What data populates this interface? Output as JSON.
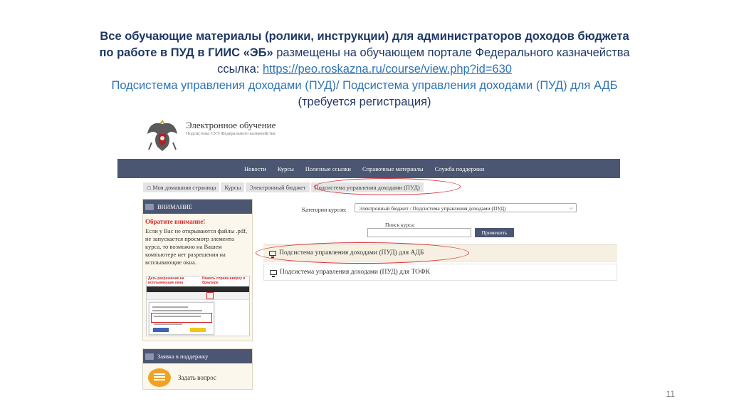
{
  "slide": {
    "title_line1": "Все обучающие материалы (ролики, инструкции) для администраторов доходов бюджета",
    "title_line2_bold": "по работе в ПУД в ГИИС «ЭБ»",
    "title_line2_rest": " размещены на обучающем  портале Федерального казначейства",
    "link_prefix": "ссылка: ",
    "link_url": "https://peo.roskazna.ru/course/view.php?id=630",
    "subsystems": "Подсистема управления доходами (ПУД)/ Подсистема управления доходами (ПУД) для АДБ",
    "registration_note": "(требуется регистрация)",
    "page_number": "11"
  },
  "site": {
    "logo_title": "Электронное обучение",
    "logo_subtitle": "Подсистема СУЭ Федерального казначейства",
    "nav": [
      "Новости",
      "Курсы",
      "Полезные ссылки",
      "Справочные материалы",
      "Служба поддержки"
    ],
    "breadcrumb": [
      "Моя домашняя страница",
      "Курсы",
      "Электронный бюджет",
      "Подсистема управления доходами (ПУД)"
    ],
    "home_icon": "home-icon"
  },
  "notice": {
    "header": "ВНИМАНИЕ",
    "title": "Обратите внимание!",
    "text": "Если у Вас не открываются файлы .pdf, не запускается просмотр элемента курса, то возможно на Вашем компьютере нет разрешения на всплывающие окна.",
    "caption_left": "Дать разрешение на всплывающие окна",
    "caption_right": "Нажать справа вверху в браузере"
  },
  "support": {
    "header": "Заявка в поддержку",
    "item_label": "Задать вопрос",
    "icon": "chat-bubble-icon"
  },
  "filters": {
    "category_label": "Категории курсов:",
    "category_value": "Электронный бюджет / Подсистема управления доходами (ПУД)",
    "search_label": "Поиск курса:",
    "search_value": "",
    "apply_label": "Применить"
  },
  "courses": [
    {
      "name": "Подсистема управления доходами (ПУД) для АДБ",
      "highlighted": true
    },
    {
      "name": "Подсистема управления доходами (ПУД) для ТОФК",
      "highlighted": false
    }
  ],
  "colors": {
    "title_dark": "#1f3864",
    "title_blue": "#2e74b5",
    "navbar": "#4b5673",
    "highlight_ellipse": "#d9333a",
    "support_icon": "#f0a323"
  }
}
